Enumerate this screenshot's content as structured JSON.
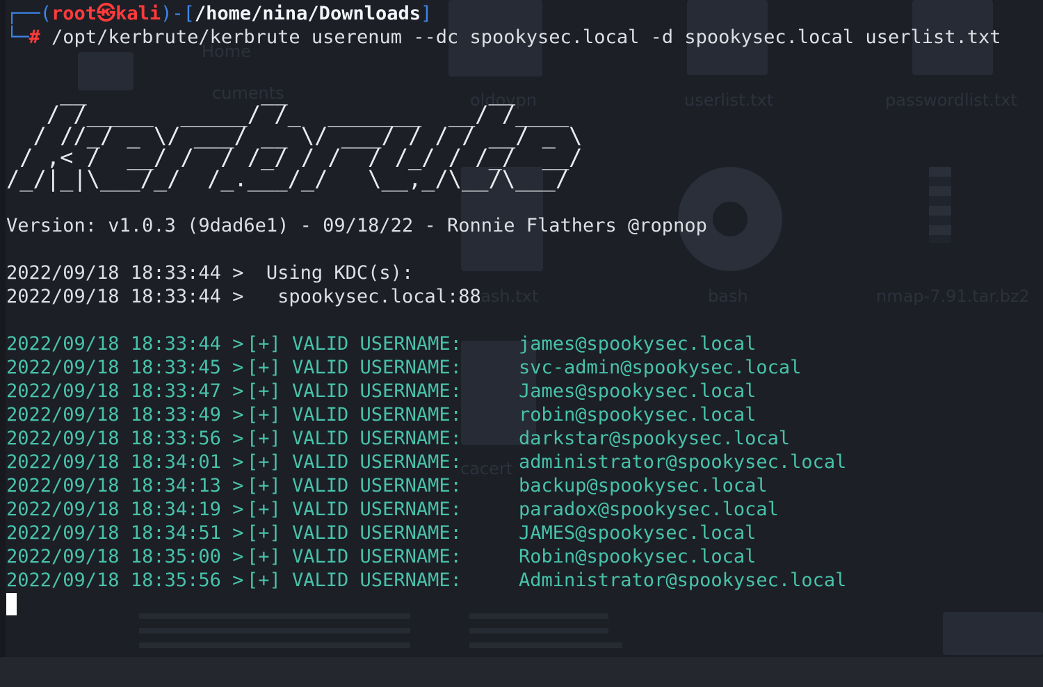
{
  "prompt": {
    "box_top": "┌──(",
    "user": "root",
    "at_symbol": "㉿",
    "host": "kali",
    "sep": ")-[",
    "cwd": "/home/nina/Downloads",
    "close": "]",
    "box_bottom": "└─",
    "hash": "#",
    "command": "/opt/kerbrute/kerbrute userenum --dc spookysec.local -d spookysec.local userlist.txt"
  },
  "banner_ascii": "    __             __               __     \n   / /_____  _____/ /_  _______  __/ /____ \n  / //_/ _ \\/ ___/ __ \\/ ___/ / / / __/ _ \\\n / ,< /  __/ /  / /_/ / /  / /_/ / /_/  __/\n/_/|_|\\___/_/  /_.___/_/   \\__,_/\\__/\\___/ ",
  "version_line": "Version: v1.0.3 (9dad6e1) - 09/18/22 - Ronnie Flathers @ropnop",
  "kdc_lines": [
    "2022/09/18 18:33:44 >  Using KDC(s):",
    "2022/09/18 18:33:44 >   spookysec.local:88"
  ],
  "valid_prefix": "[+] VALID USERNAME:",
  "results": [
    {
      "ts": "2022/09/18 18:33:44 >",
      "user": "james@spookysec.local"
    },
    {
      "ts": "2022/09/18 18:33:45 >",
      "user": "svc-admin@spookysec.local"
    },
    {
      "ts": "2022/09/18 18:33:47 >",
      "user": "James@spookysec.local"
    },
    {
      "ts": "2022/09/18 18:33:49 >",
      "user": "robin@spookysec.local"
    },
    {
      "ts": "2022/09/18 18:33:56 >",
      "user": "darkstar@spookysec.local"
    },
    {
      "ts": "2022/09/18 18:34:01 >",
      "user": "administrator@spookysec.local"
    },
    {
      "ts": "2022/09/18 18:34:13 >",
      "user": "backup@spookysec.local"
    },
    {
      "ts": "2022/09/18 18:34:19 >",
      "user": "paradox@spookysec.local"
    },
    {
      "ts": "2022/09/18 18:34:51 >",
      "user": "JAMES@spookysec.local"
    },
    {
      "ts": "2022/09/18 18:35:00 >",
      "user": "Robin@spookysec.local"
    },
    {
      "ts": "2022/09/18 18:35:56 >",
      "user": "Administrator@spookysec.local"
    }
  ],
  "desktop_labels": {
    "home": "Home",
    "documents": "cuments",
    "oldovpn": "oldovpn",
    "userlist": "userlist.txt",
    "passwordlist": "passwordlist.txt",
    "hash": "hash.txt",
    "bash": "bash",
    "nmap": "nmap-7.91.tar.bz2",
    "cacert": "cacert"
  },
  "colors": {
    "background": "#1c1f26",
    "prompt_red": "#ff3b3b",
    "prompt_blue": "#3d85e8",
    "result_teal": "#48c2aa",
    "text": "#dcdfe4"
  }
}
